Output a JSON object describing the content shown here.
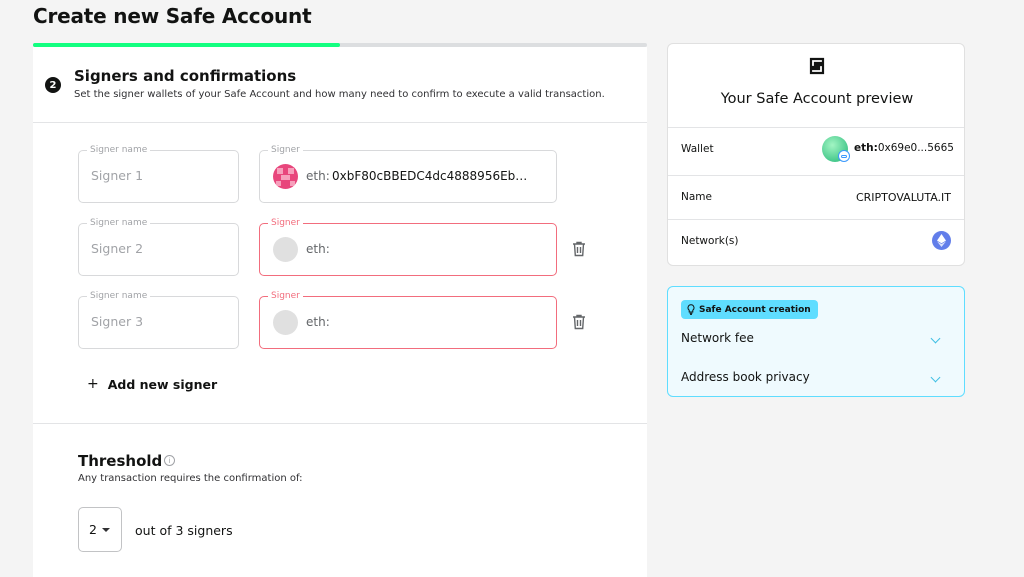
{
  "page": {
    "title": "Create new Safe Account"
  },
  "progress": {
    "fraction": 0.5
  },
  "step": {
    "number": "2",
    "title": "Signers and confirmations",
    "subtitle": "Set the signer wallets of your Safe Account and how many need to confirm to execute a valid transaction."
  },
  "signers": [
    {
      "name_label": "Signer name",
      "name_placeholder": "Signer 1",
      "address_label": "Signer",
      "prefix": "eth:",
      "address": "0xbF80cBBEDC4dc4888956Eb…"
    },
    {
      "name_label": "Signer name",
      "name_placeholder": "Signer 2",
      "address_label": "Signer",
      "prefix": "eth:",
      "address": ""
    },
    {
      "name_label": "Signer name",
      "name_placeholder": "Signer 3",
      "address_label": "Signer",
      "prefix": "eth:",
      "address": ""
    }
  ],
  "add_signer": {
    "plus": "+",
    "label": "Add new signer"
  },
  "threshold": {
    "title": "Threshold",
    "description": "Any transaction requires the confirmation of:",
    "selected": "2",
    "suffix": "out of 3 signers"
  },
  "preview": {
    "title": "Your Safe Account preview",
    "wallet_label": "Wallet",
    "wallet_prefix": "eth:",
    "wallet_address": "0x69e0...5665",
    "name_label": "Name",
    "name_value": "CRIPTOVALUTA.IT",
    "network_label": "Network(s)"
  },
  "info": {
    "badge": "Safe Account creation",
    "items": [
      "Network fee",
      "Address book privacy"
    ]
  },
  "colors": {
    "accent_green": "#12ff80",
    "error_red": "#f26d7d",
    "info_blue": "#5fddff",
    "eth_purple": "#627eea"
  },
  "icons": [
    "safe-logo-icon",
    "trash-icon",
    "info-icon",
    "lightbulb-icon",
    "chevron-down-icon",
    "ethereum-icon"
  ]
}
